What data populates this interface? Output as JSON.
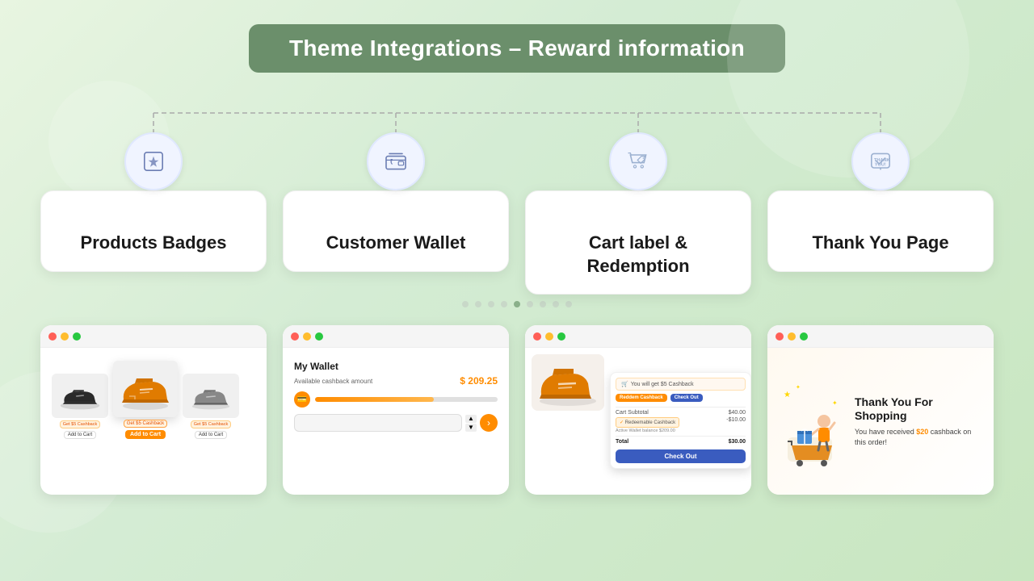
{
  "page": {
    "title": "Theme Integrations - Reward information",
    "background_color": "#d4ecd4"
  },
  "header": {
    "title": "Theme Integrations – Reward information",
    "bg_color": "#6b8f6b"
  },
  "cards": [
    {
      "id": "products-badges",
      "title": "Products Badges",
      "icon": "badge-star"
    },
    {
      "id": "customer-wallet",
      "title": "Customer Wallet",
      "icon": "wallet"
    },
    {
      "id": "cart-redemption",
      "title": "Cart label & Redemption",
      "icon": "cart-tag"
    },
    {
      "id": "thank-you",
      "title": "Thank You Page",
      "icon": "thank-you"
    }
  ],
  "screenshots": {
    "wallet": {
      "title": "My Wallet",
      "label": "Available cashback amount",
      "amount": "$ 209.25"
    },
    "thank_you": {
      "title": "Thank You For Shopping",
      "subtitle": "You have received $20 cashback on this order!",
      "amount": "$20"
    },
    "cart": {
      "cashback_banner": "You will get $5 Cashback",
      "redeem_btn": "Reddem Cashback",
      "checkout_btn": "Check Out",
      "subtotal_label": "Cart Subtotal",
      "subtotal_val": "$40.00",
      "cashback_label": "Redeemable Cashback",
      "cashback_sub": "Active Wallet balance $209.00",
      "cashback_val": "-$10.00",
      "total_label": "Total",
      "total_val": "$30.00",
      "checkout_label": "Check Out"
    },
    "badges": {
      "badge_text": "Get $5 Cashback",
      "add_btn": "Add to Cart"
    }
  },
  "dots": [
    1,
    2,
    3,
    4,
    5,
    6,
    7,
    8,
    9
  ],
  "active_dot": 5
}
